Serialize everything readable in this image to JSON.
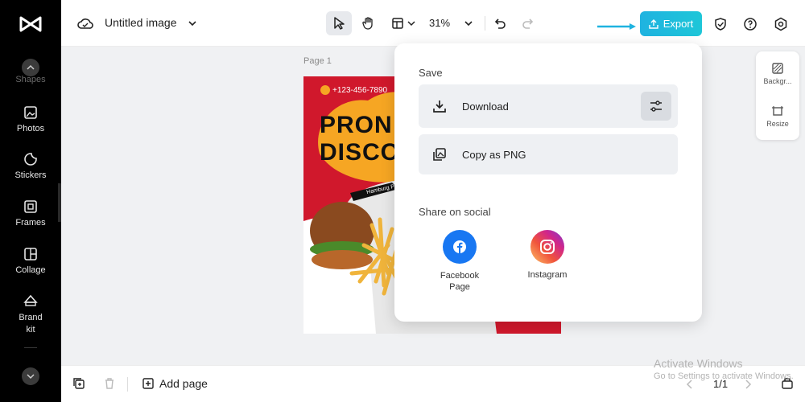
{
  "topbar": {
    "title": "Untitled image",
    "zoom": "31%",
    "export_label": "Export"
  },
  "sidebar": {
    "items": [
      {
        "label": "Shapes"
      },
      {
        "label": "Photos"
      },
      {
        "label": "Stickers"
      },
      {
        "label": "Frames"
      },
      {
        "label": "Collage"
      },
      {
        "label": "Brand kit"
      }
    ]
  },
  "canvas": {
    "page_label": "Page 1",
    "poster": {
      "phone": "+123-456-7890",
      "headline_1": "PRON",
      "headline_2": "DISCO",
      "tag": "Hamburg P..."
    }
  },
  "right_panel": {
    "background_label": "Backgr...",
    "resize_label": "Resize"
  },
  "export_popup": {
    "save_heading": "Save",
    "download_label": "Download",
    "copy_png_label": "Copy as PNG",
    "share_heading": "Share on social",
    "facebook_label": "Facebook Page",
    "instagram_label": "Instagram"
  },
  "bottombar": {
    "add_page_label": "Add page",
    "page_count": "1/1"
  },
  "watermark": {
    "line1": "Activate Windows",
    "line2": "Go to Settings to activate Windows."
  },
  "colors": {
    "export_accent": "#1fb3e0",
    "poster_red": "#d0182c",
    "poster_yellow": "#f6a623",
    "facebook_blue": "#1877f2"
  }
}
